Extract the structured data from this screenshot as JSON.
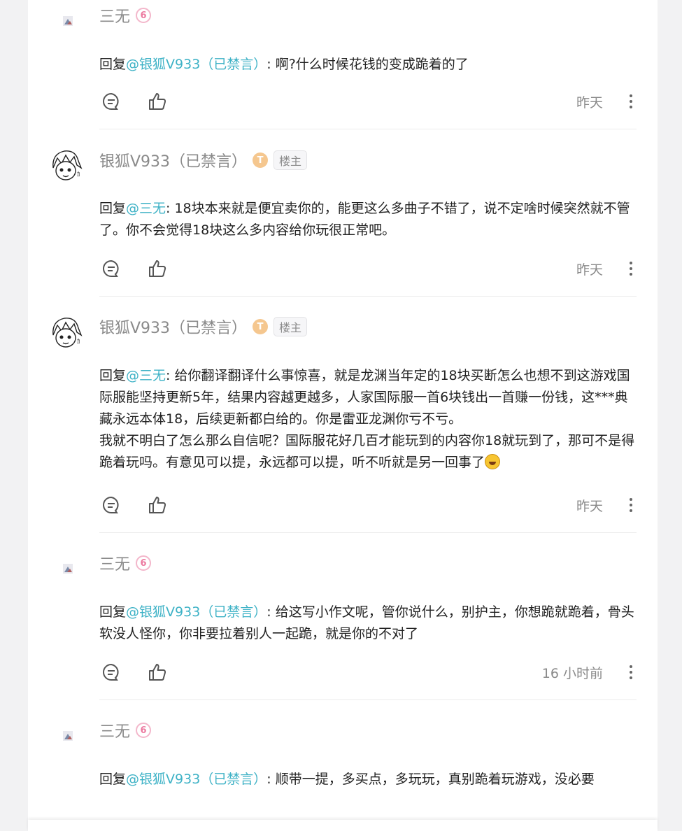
{
  "comments": [
    {
      "user": "三无",
      "badge_level": "6",
      "reply_prefix": "回复",
      "mention": "@银狐V933（已禁言）",
      "text": ": 啊?什么时候花钱的变成跪着的了",
      "time": "昨天"
    },
    {
      "user": "银狐V933（已禁言）",
      "badge_t": "T",
      "tag": "楼主",
      "reply_prefix": "回复",
      "mention": "@三无",
      "text": ": 18块本来就是便宜卖你的，能更这么多曲子不错了，说不定啥时候突然就不管了。你不会觉得18块这么多内容给你玩很正常吧。",
      "time": "昨天"
    },
    {
      "user": "银狐V933（已禁言）",
      "badge_t": "T",
      "tag": "楼主",
      "reply_prefix": "回复",
      "mention": "@三无",
      "text": ": 给你翻译翻译什么事惊喜，就是龙渊当年定的18块买断怎么也想不到这游戏国际服能坚持更新5年，结果内容越更越多，人家国际服一首6块钱出一首赚一份钱，这***典藏永远本体18，后续更新都白给的。你是雷亚龙渊你亏不亏。",
      "text2": "我就不明白了怎么那么自信呢？国际服花好几百才能玩到的内容你18就玩到了，那可不是得跪着玩吗。有意见可以提，永远都可以提，听不听就是另一回事了",
      "time": "昨天"
    },
    {
      "user": "三无",
      "badge_level": "6",
      "reply_prefix": "回复",
      "mention": "@银狐V933（已禁言）",
      "text": ": 给这写小作文呢，管你说什么，别护主，你想跪就跪着，骨头软没人怪你，你非要拉着别人一起跪，就是你的不对了",
      "time": "16 小时前"
    },
    {
      "user": "三无",
      "badge_level": "6",
      "reply_prefix": "回复",
      "mention": "@银狐V933（已禁言）",
      "text": ": 顺带一提，多买点，多玩玩，真别跪着玩游戏，没必要"
    }
  ]
}
